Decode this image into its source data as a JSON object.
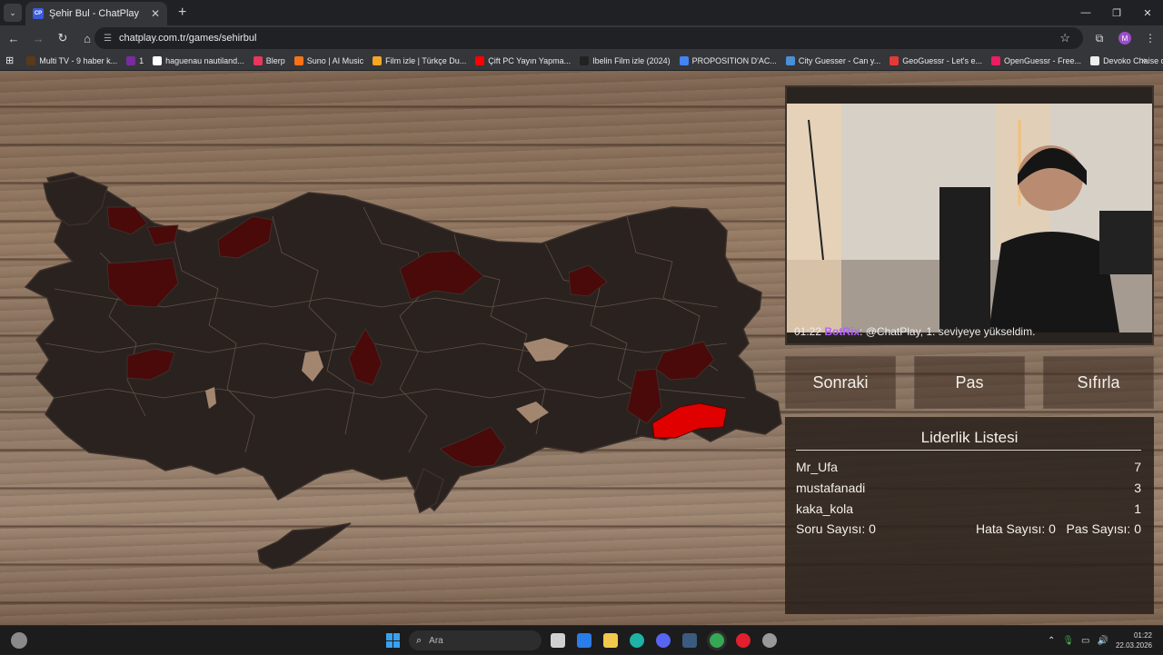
{
  "browser": {
    "tab_title": "Şehir Bul - ChatPlay",
    "tab_favicon": "CP",
    "url": "chatplay.com.tr/games/sehirbul",
    "profile_initial": "M",
    "bookmarks": [
      {
        "label": "Multi TV - 9 haber k...",
        "color": "#5a3a1a"
      },
      {
        "label": "1",
        "color": "#7b2ba0"
      },
      {
        "label": "haguenau nautiland...",
        "color": "#ffffff"
      },
      {
        "label": "Blerp",
        "color": "#e8365d"
      },
      {
        "label": "Suno | AI Music",
        "color": "#f97316"
      },
      {
        "label": "Film izle | Türkçe Du...",
        "color": "#f5a623"
      },
      {
        "label": "Çift PC Yayın Yapma...",
        "color": "#ff0000"
      },
      {
        "label": "Ibelin Film izle (2024)",
        "color": "#222222"
      },
      {
        "label": "PROPOSITION D'AC...",
        "color": "#4285f4"
      },
      {
        "label": "City Guesser - Can y...",
        "color": "#4a90d9"
      },
      {
        "label": "GeoGuessr - Let's e...",
        "color": "#e53935"
      },
      {
        "label": "OpenGuessr - Free...",
        "color": "#e91e63"
      },
      {
        "label": "Devoko Chaise de G...",
        "color": "#eeeeee"
      }
    ]
  },
  "stream": {
    "chat_time": "01:22",
    "chat_user": "BotRix",
    "chat_text": ": @ChatPlay, 1. seviyeye yükseldim."
  },
  "controls": {
    "next_label": "Sonraki",
    "pass_label": "Pas",
    "reset_label": "Sıfırla"
  },
  "leaderboard": {
    "title": "Liderlik Listesi",
    "entries": [
      {
        "name": "Mr_Ufa",
        "score": "7"
      },
      {
        "name": "mustafanadi",
        "score": "3"
      },
      {
        "name": "kaka_kola",
        "score": "1"
      }
    ],
    "question_count": "Soru Sayısı: 0",
    "error_count": "Hata Sayısı: 0",
    "pass_count": "Pas Sayısı: 0"
  },
  "taskbar": {
    "search_placeholder": "Ara",
    "time": "01:22",
    "date": "22.03.2026"
  },
  "colors": {
    "province_default": "#2a221f",
    "province_found": "#4a0a0a",
    "province_highlight": "#e00000"
  }
}
